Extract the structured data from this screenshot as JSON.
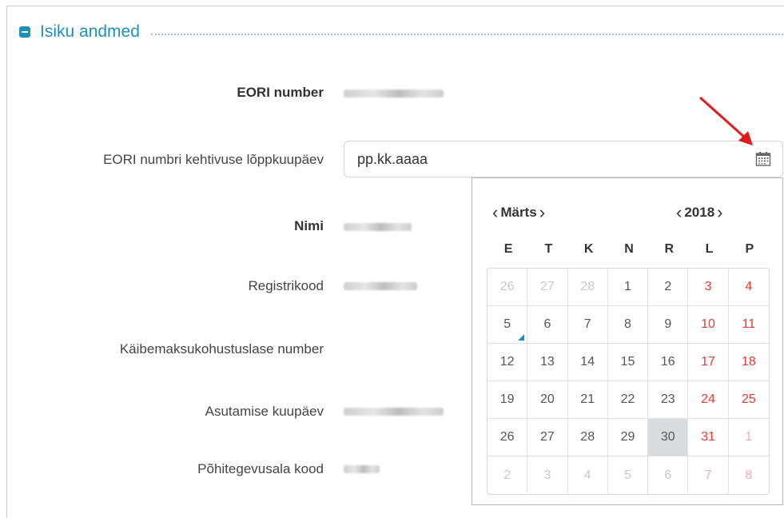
{
  "section": {
    "title": "Isiku andmed"
  },
  "fields": {
    "eori_number": {
      "label": "EORI number"
    },
    "eori_end": {
      "label": "EORI numbri kehtivuse lõppkuupäev",
      "placeholder": "pp.kk.aaaa",
      "value": ""
    },
    "name": {
      "label": "Nimi"
    },
    "reg_code": {
      "label": "Registrikood"
    },
    "vat_number": {
      "label": "Käibemaksukohustuslase number"
    },
    "founding_date": {
      "label": "Asutamise kuupäev"
    },
    "activity_code": {
      "label": "Põhitegevusala kood"
    }
  },
  "calendar": {
    "month": "Märts",
    "year": "2018",
    "prev_icon": "chevron-left-icon",
    "next_icon": "chevron-right-icon",
    "weekdays": [
      "E",
      "T",
      "K",
      "N",
      "R",
      "L",
      "P"
    ],
    "days": [
      {
        "d": "26",
        "other": true
      },
      {
        "d": "27",
        "other": true
      },
      {
        "d": "28",
        "other": true
      },
      {
        "d": "1"
      },
      {
        "d": "2"
      },
      {
        "d": "3",
        "weekend": true
      },
      {
        "d": "4",
        "weekend": true
      },
      {
        "d": "5",
        "today": true
      },
      {
        "d": "6"
      },
      {
        "d": "7"
      },
      {
        "d": "8"
      },
      {
        "d": "9"
      },
      {
        "d": "10",
        "weekend": true
      },
      {
        "d": "11",
        "weekend": true
      },
      {
        "d": "12"
      },
      {
        "d": "13"
      },
      {
        "d": "14"
      },
      {
        "d": "15"
      },
      {
        "d": "16"
      },
      {
        "d": "17",
        "weekend": true
      },
      {
        "d": "18",
        "weekend": true
      },
      {
        "d": "19"
      },
      {
        "d": "20"
      },
      {
        "d": "21"
      },
      {
        "d": "22"
      },
      {
        "d": "23"
      },
      {
        "d": "24",
        "weekend": true
      },
      {
        "d": "25",
        "weekend": true
      },
      {
        "d": "26"
      },
      {
        "d": "27"
      },
      {
        "d": "28"
      },
      {
        "d": "29"
      },
      {
        "d": "30",
        "selected": true
      },
      {
        "d": "31",
        "weekend": true
      },
      {
        "d": "1",
        "weekend": true,
        "other": true
      },
      {
        "d": "2",
        "other": true
      },
      {
        "d": "3",
        "other": true
      },
      {
        "d": "4",
        "other": true
      },
      {
        "d": "5",
        "other": true
      },
      {
        "d": "6",
        "other": true
      },
      {
        "d": "7",
        "weekend": true,
        "other": true
      },
      {
        "d": "8",
        "weekend": true,
        "other": true
      }
    ]
  },
  "colors": {
    "accent": "#1e8fbf",
    "weekend": "#e53935",
    "selected_bg": "#d9dcde",
    "annotation_arrow": "#e01b1b"
  },
  "icons": {
    "collapse": "minus-square-icon",
    "calendar": "calendar-icon",
    "annotation": "red-arrow-icon"
  }
}
